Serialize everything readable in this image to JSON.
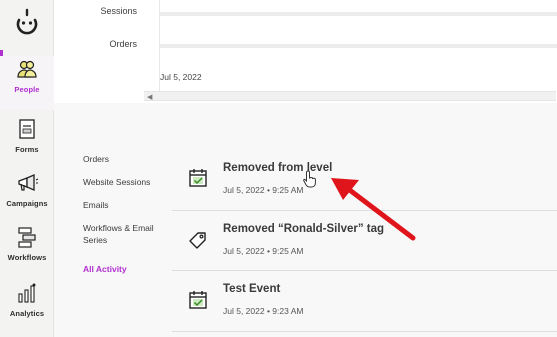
{
  "nav": {
    "items": [
      {
        "key": "people",
        "label": "People",
        "active": true
      },
      {
        "key": "forms",
        "label": "Forms",
        "active": false
      },
      {
        "key": "campaigns",
        "label": "Campaigns",
        "active": false
      },
      {
        "key": "workflows",
        "label": "Workflows",
        "active": false
      },
      {
        "key": "analytics",
        "label": "Analytics",
        "active": false
      }
    ]
  },
  "dropdown": {
    "items": [
      "Sessions",
      "Orders"
    ]
  },
  "top": {
    "date": "Jul 5, 2022"
  },
  "filters": {
    "items": [
      "Orders",
      "Website Sessions",
      "Emails",
      "Workflows & Email Series",
      "All Activity"
    ],
    "active_index": 4
  },
  "activities": [
    {
      "title": "Removed from level",
      "time": "Jul 5, 2022 • 9:25 AM",
      "icon": "calendar-check-icon"
    },
    {
      "title": "Removed “Ronald-Silver” tag",
      "time": "Jul 5, 2022 • 9:25 AM",
      "icon": "tag-icon"
    },
    {
      "title": "Test Event",
      "time": "Jul 5, 2022 • 9:23 AM",
      "icon": "calendar-check-icon"
    }
  ],
  "colors": {
    "accent": "#b02fd0",
    "annotation_arrow": "#e0151b",
    "check_green": "#6cc04a"
  }
}
